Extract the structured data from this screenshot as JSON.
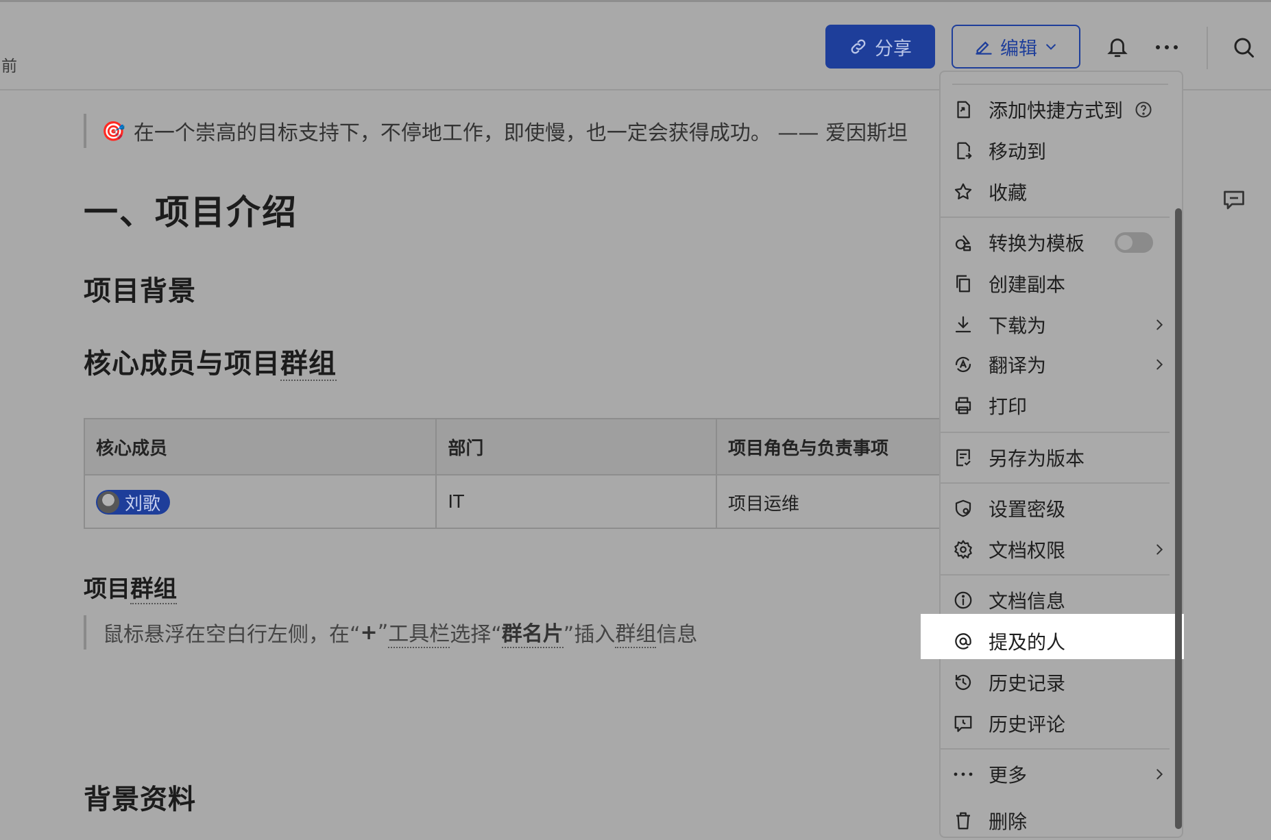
{
  "header": {
    "time_suffix": "前",
    "share_label": "分享",
    "edit_label": "编辑"
  },
  "document": {
    "quote_emoji": "🎯",
    "quote_text": "在一个崇高的目标支持下，不停地工作，即使慢，也一定会获得成功。 —— 爱因斯坦",
    "section_title": "一、项目介绍",
    "background_heading": "项目背景",
    "members_heading_prefix": "核心成员与项目",
    "members_heading_group": "群组",
    "table": {
      "headers": [
        "核心成员",
        "部门",
        "项目角色与负责事项"
      ],
      "rows": [
        {
          "member": "刘歌",
          "dept": "IT",
          "role": "项目运维"
        }
      ]
    },
    "group_heading_prefix": "项目",
    "group_heading_group": "群组",
    "hint": {
      "p1": "鼠标悬浮在空白行左侧，在“",
      "plus": "+",
      "p2": "”",
      "toolbar": "工具栏",
      "p3": "选择“",
      "card": "群名片",
      "p4": "”插入",
      "group": "群组",
      "p5": "信息"
    },
    "materials_heading": "背景资料"
  },
  "menu": {
    "items": [
      {
        "label": "添加快捷方式到",
        "icon": "shortcut-icon"
      },
      {
        "label": "移动到",
        "icon": "move-icon"
      },
      {
        "label": "收藏",
        "icon": "star-icon"
      },
      {
        "label": "转换为模板",
        "icon": "template-icon"
      },
      {
        "label": "创建副本",
        "icon": "copy-icon"
      },
      {
        "label": "下载为",
        "icon": "download-icon"
      },
      {
        "label": "翻译为",
        "icon": "translate-icon"
      },
      {
        "label": "打印",
        "icon": "print-icon"
      },
      {
        "label": "另存为版本",
        "icon": "version-icon"
      },
      {
        "label": "设置密级",
        "icon": "security-level-icon"
      },
      {
        "label": "文档权限",
        "icon": "gear-icon"
      },
      {
        "label": "文档信息",
        "icon": "info-icon"
      },
      {
        "label": "提及的人",
        "icon": "at-icon"
      },
      {
        "label": "历史记录",
        "icon": "history-icon"
      },
      {
        "label": "历史评论",
        "icon": "history-comment-icon"
      },
      {
        "label": "更多",
        "icon": "more-icon"
      },
      {
        "label": "删除",
        "icon": "trash-icon"
      }
    ],
    "template_toggle_on": false,
    "highlighted_item": "提及的人"
  },
  "colors": {
    "accent": "#1e3e9a",
    "overlay_bg": "#a9a9a9",
    "highlight": "#ffffff"
  }
}
